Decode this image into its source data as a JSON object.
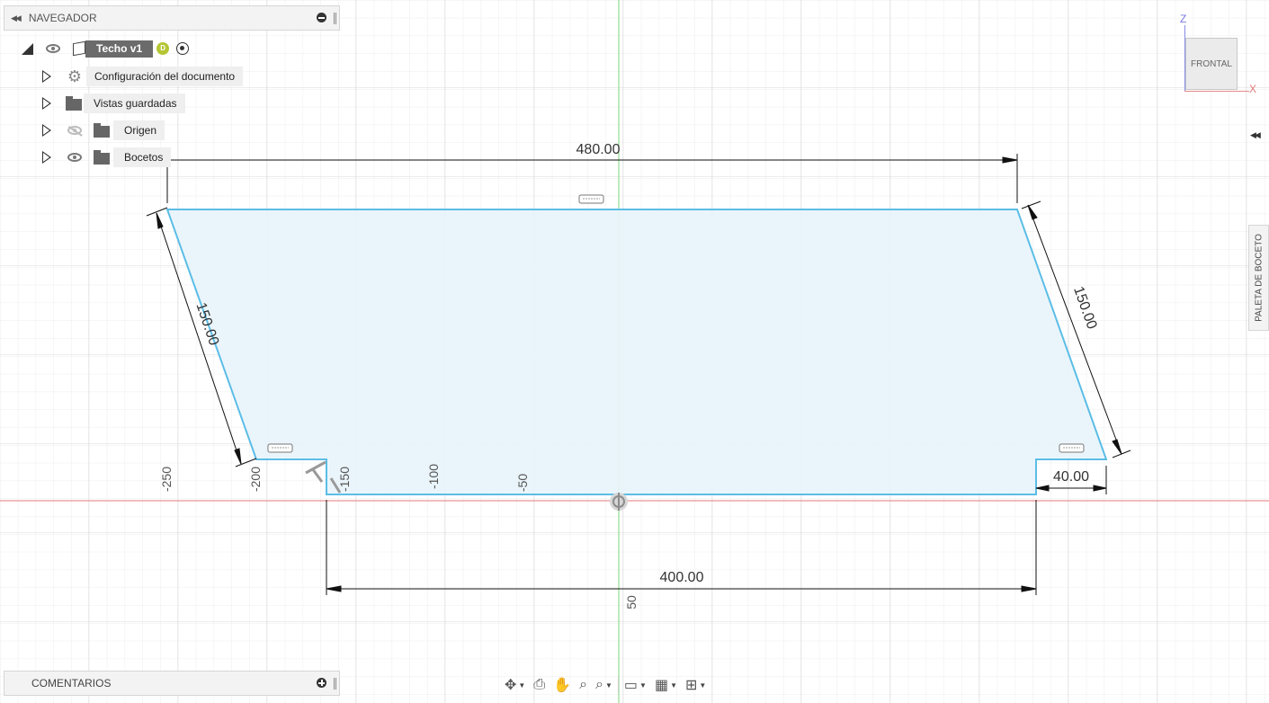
{
  "navigator": {
    "title": "NAVEGADOR",
    "root": {
      "label": "Techo v1",
      "badge": "D"
    },
    "items": [
      {
        "label": "Configuración del documento",
        "icon": "gear-icon"
      },
      {
        "label": "Vistas guardadas",
        "icon": "folder-icon"
      },
      {
        "label": "Origen",
        "icon": "folder-icon",
        "visibility": "hidden"
      },
      {
        "label": "Bocetos",
        "icon": "folder-icon",
        "visibility": "visible"
      }
    ]
  },
  "viewcube": {
    "face": "FRONTAL",
    "axis_z": "Z",
    "axis_x": "X"
  },
  "palette": {
    "label": "PALETA DE BOCETO"
  },
  "comments": {
    "title": "COMENTARIOS"
  },
  "sketch": {
    "dimensions": {
      "top_width": "480.00",
      "bottom_width": "400.00",
      "left_side": "150.00",
      "right_side": "150.00",
      "step": "40.00"
    },
    "ruler_labels": [
      "-250",
      "-200",
      "-150",
      "-100",
      "-50",
      "50"
    ]
  },
  "toolbar": {
    "items": [
      "orbit-icon",
      "look-at-icon",
      "pan-icon",
      "zoom-icon",
      "fit-icon",
      "display-settings-icon",
      "grid-settings-icon",
      "viewports-icon"
    ]
  },
  "colors": {
    "sketch_line": "#5bbde6",
    "sketch_fill": "#e8f4fb",
    "grid_minor": "#ececec",
    "grid_major": "#d7d7d7",
    "axis_x": "#e67b7b",
    "axis_y": "#7ed67e",
    "dimension": "#000000"
  }
}
